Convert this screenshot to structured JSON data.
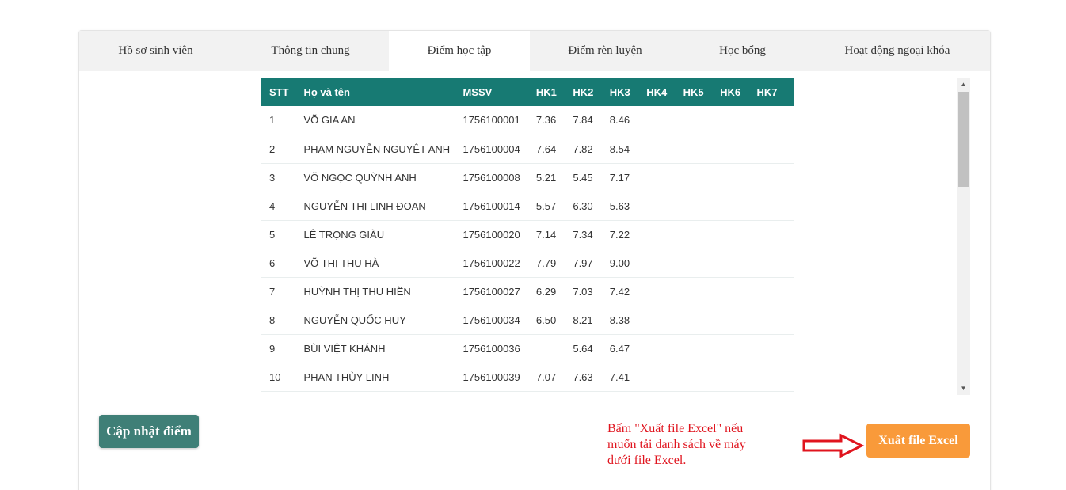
{
  "tabs": [
    {
      "label": "Hồ sơ sinh viên"
    },
    {
      "label": "Thông tin chung"
    },
    {
      "label": "Điểm học tập"
    },
    {
      "label": "Điểm rèn luyện"
    },
    {
      "label": "Học bổng"
    },
    {
      "label": "Hoạt động ngoại khóa"
    }
  ],
  "active_tab": "Điểm học tập",
  "table": {
    "headers": [
      "STT",
      "Họ và tên",
      "MSSV",
      "HK1",
      "HK2",
      "HK3",
      "HK4",
      "HK5",
      "HK6",
      "HK7"
    ],
    "rows": [
      [
        "1",
        "VÕ GIA AN",
        "1756100001",
        "7.36",
        "7.84",
        "8.46",
        "",
        "",
        "",
        ""
      ],
      [
        "2",
        "PHẠM NGUYỄN NGUYỆT ANH",
        "1756100004",
        "7.64",
        "7.82",
        "8.54",
        "",
        "",
        "",
        ""
      ],
      [
        "3",
        "VÕ NGỌC QUỲNH ANH",
        "1756100008",
        "5.21",
        "5.45",
        "7.17",
        "",
        "",
        "",
        ""
      ],
      [
        "4",
        "NGUYỄN THỊ LINH ĐOAN",
        "1756100014",
        "5.57",
        "6.30",
        "5.63",
        "",
        "",
        "",
        ""
      ],
      [
        "5",
        "LÊ TRỌNG GIÀU",
        "1756100020",
        "7.14",
        "7.34",
        "7.22",
        "",
        "",
        "",
        ""
      ],
      [
        "6",
        "VÕ THỊ THU HÀ",
        "1756100022",
        "7.79",
        "7.97",
        "9.00",
        "",
        "",
        "",
        ""
      ],
      [
        "7",
        "HUỲNH THỊ THU HIỀN",
        "1756100027",
        "6.29",
        "7.03",
        "7.42",
        "",
        "",
        "",
        ""
      ],
      [
        "8",
        "NGUYỄN QUỐC HUY",
        "1756100034",
        "6.50",
        "8.21",
        "8.38",
        "",
        "",
        "",
        ""
      ],
      [
        "9",
        "BÙI VIỆT KHÁNH",
        "1756100036",
        "",
        "5.64",
        "6.47",
        "",
        "",
        "",
        ""
      ],
      [
        "10",
        "PHAN THÙY LINH",
        "1756100039",
        "7.07",
        "7.63",
        "7.41",
        "",
        "",
        "",
        ""
      ]
    ]
  },
  "buttons": {
    "update_label": "Cập nhật điểm",
    "export_label": "Xuất file Excel"
  },
  "note": {
    "line1": "Bấm \"Xuất file Excel\" nếu",
    "line2": "muốn tải danh sách về máy",
    "line3": "dưới  file Excel."
  },
  "colors": {
    "header_bg": "#177a73",
    "update_button": "#3f7f77",
    "export_button": "#f99a3a",
    "note_text": "#e0141e"
  },
  "icons": {
    "scroll_up": "triangle-up-icon",
    "scroll_down": "triangle-down-icon",
    "arrow": "right-arrow-icon"
  }
}
